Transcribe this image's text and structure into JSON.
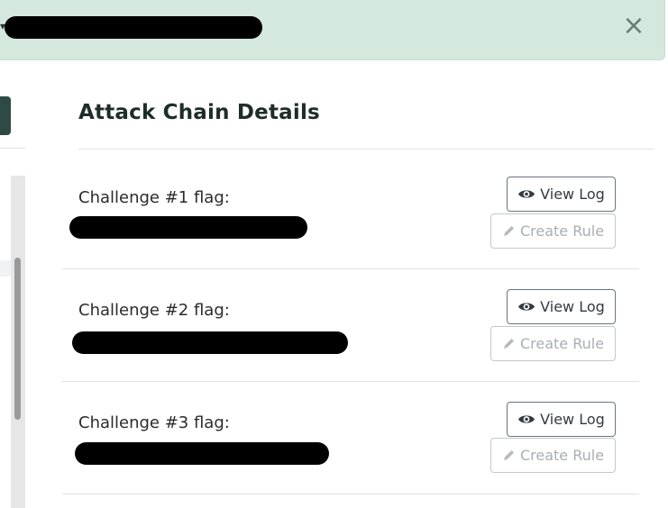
{
  "alert": {
    "close_glyph": "×",
    "bg_color": "#d4e8dd"
  },
  "panel": {
    "title": "Attack Chain Details"
  },
  "challenges": [
    {
      "label": "Challenge #1 flag:",
      "view_label": "View Log",
      "rule_label": "Create Rule"
    },
    {
      "label": "Challenge #2 flag:",
      "view_label": "View Log",
      "rule_label": "Create Rule"
    },
    {
      "label": "Challenge #3 flag:",
      "view_label": "View Log",
      "rule_label": "Create Rule"
    }
  ],
  "icons": {
    "view": "eye-icon",
    "create": "pencil-icon",
    "close": "close-icon"
  }
}
